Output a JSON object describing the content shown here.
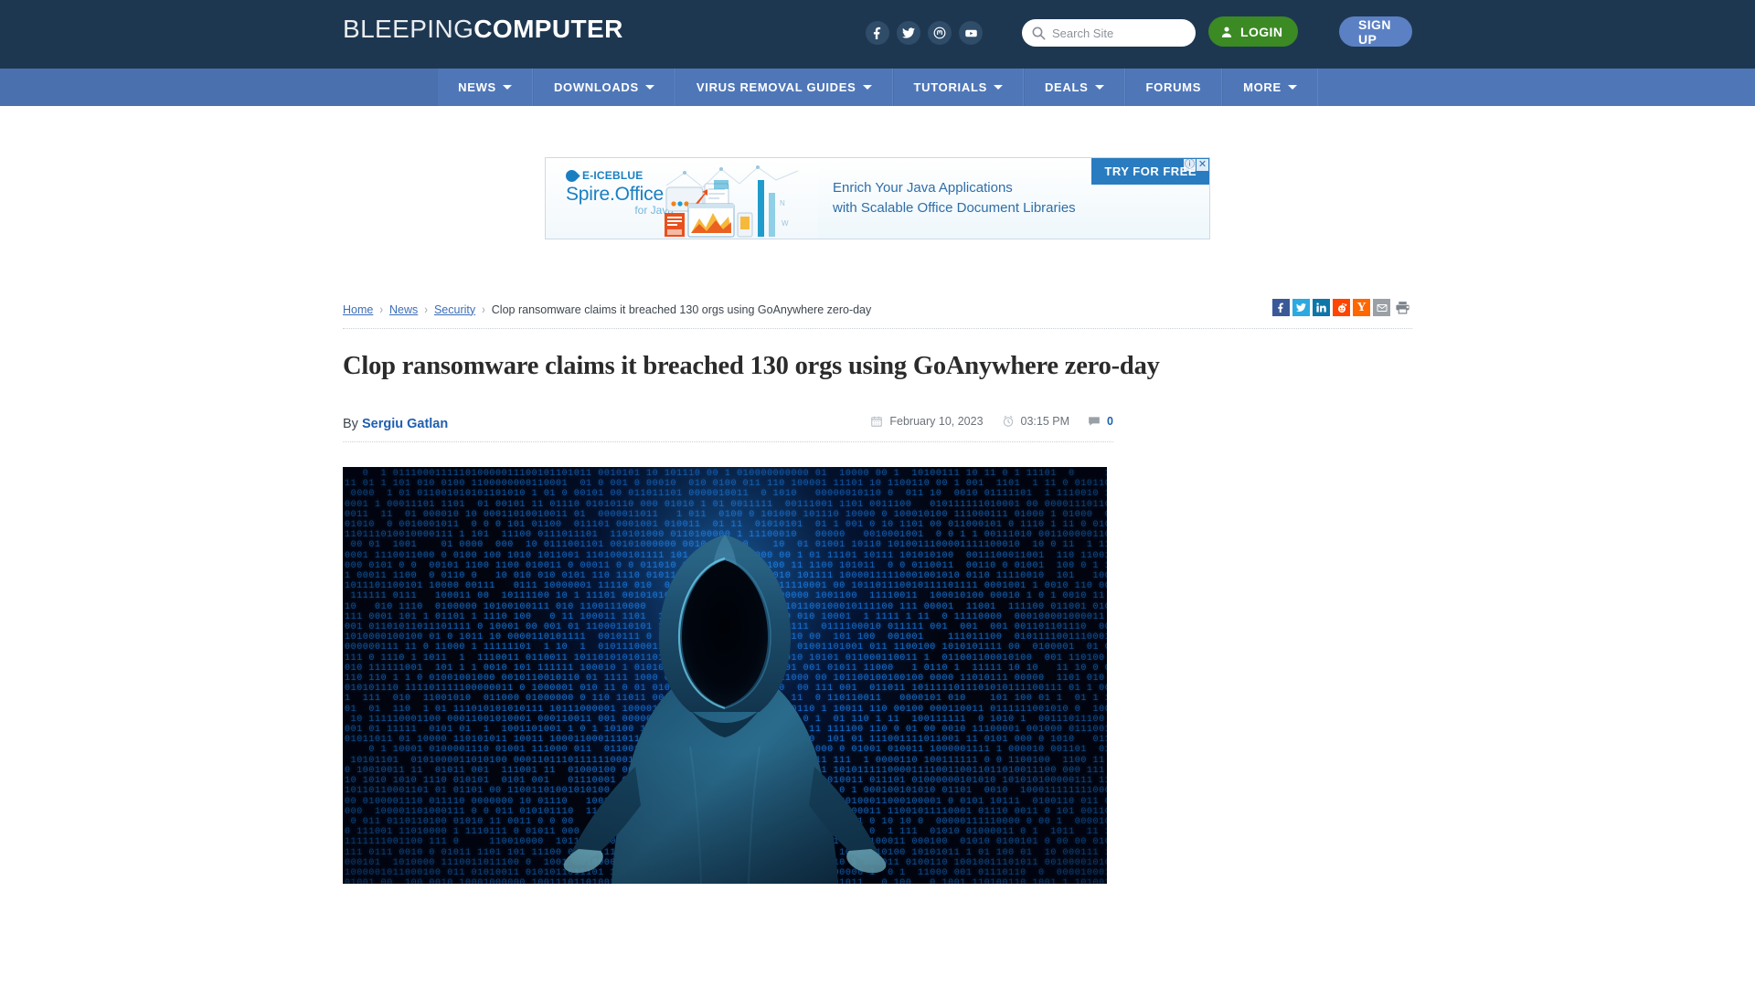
{
  "site": {
    "logo_light": "BLEEPING",
    "logo_bold": "COMPUTER"
  },
  "header": {
    "social": [
      {
        "name": "facebook-icon",
        "label": "Facebook"
      },
      {
        "name": "twitter-icon",
        "label": "Twitter"
      },
      {
        "name": "mastodon-icon",
        "label": "Mastodon"
      },
      {
        "name": "youtube-icon",
        "label": "YouTube"
      }
    ],
    "search": {
      "placeholder": "Search Site",
      "value": ""
    },
    "login_label": "LOGIN",
    "signup_label": "SIGN UP"
  },
  "nav": {
    "items": [
      {
        "label": "NEWS",
        "caret": true
      },
      {
        "label": "DOWNLOADS",
        "caret": true
      },
      {
        "label": "VIRUS REMOVAL GUIDES",
        "caret": true
      },
      {
        "label": "TUTORIALS",
        "caret": true
      },
      {
        "label": "DEALS",
        "caret": true
      },
      {
        "label": "FORUMS",
        "caret": false
      },
      {
        "label": "MORE",
        "caret": true
      }
    ]
  },
  "ad": {
    "brand": "E-ICEBLUE",
    "product": "Spire.Office",
    "product_sub": "for Java",
    "line1": "Enrich Your Java Applications",
    "line2": "with Scalable Office Document Libraries",
    "cta": "TRY FOR FREE",
    "info_badge": "ⓘ",
    "close_badge": "✕"
  },
  "breadcrumb": {
    "items": [
      {
        "label": "Home",
        "link": true
      },
      {
        "label": "News",
        "link": true
      },
      {
        "label": "Security",
        "link": true
      },
      {
        "label": "Clop ransomware claims it breached 130 orgs using GoAnywhere zero-day",
        "link": false
      }
    ],
    "separator": "›"
  },
  "share": {
    "items": [
      {
        "name": "share-facebook-icon",
        "label": "f"
      },
      {
        "name": "share-twitter-icon",
        "label": ""
      },
      {
        "name": "share-linkedin-icon",
        "label": "in"
      },
      {
        "name": "share-reddit-icon",
        "label": ""
      },
      {
        "name": "share-hackernews-icon",
        "label": "Y"
      },
      {
        "name": "share-email-icon",
        "label": ""
      },
      {
        "name": "share-print-icon",
        "label": ""
      }
    ]
  },
  "article": {
    "title": "Clop ransomware claims it breached 130 orgs using GoAnywhere zero-day",
    "by_prefix": "By",
    "author": "Sergiu Gatlan",
    "date": "February 10, 2023",
    "time": "03:15 PM",
    "comment_count": "0",
    "hero_alt": "Hooded hacker figure in front of blue binary code wall"
  },
  "colors": {
    "header_bg": "#1e3751",
    "nav_bg": "#4f77b8",
    "login_green": "#3b8a24",
    "signup_blue": "#5b81c4",
    "link_blue": "#1f5fb0",
    "ad_blue": "#2a7cc0"
  }
}
